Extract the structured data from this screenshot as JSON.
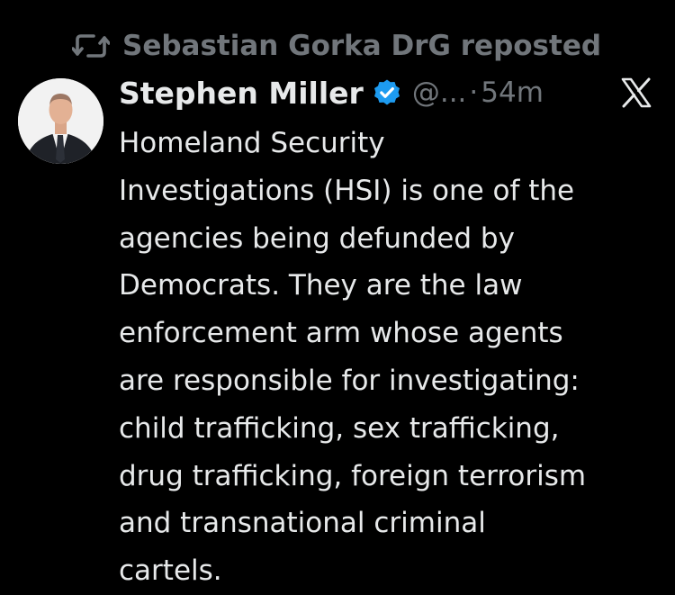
{
  "repost": {
    "icon": "repost-icon",
    "label": "Sebastian Gorka DrG reposted"
  },
  "post": {
    "avatar_icon": "avatar",
    "display_name": "Stephen Miller",
    "verified_icon": "verified-badge-icon",
    "handle": "@...",
    "separator": "·",
    "time": "54m",
    "platform_icon": "x-logo-icon",
    "text": "Homeland Security\nInvestigations (HSI) is one of the\nagencies being defunded by\nDemocrats. They are the law\nenforcement arm whose agents\nare responsible for investigating:\nchild trafficking, sex trafficking,\ndrug trafficking, foreign terrorism\nand transnational criminal\ncartels."
  },
  "colors": {
    "background": "#000000",
    "primary_text": "#e7e9ea",
    "secondary_text": "#71767b",
    "verified_blue": "#1d9bf0"
  }
}
